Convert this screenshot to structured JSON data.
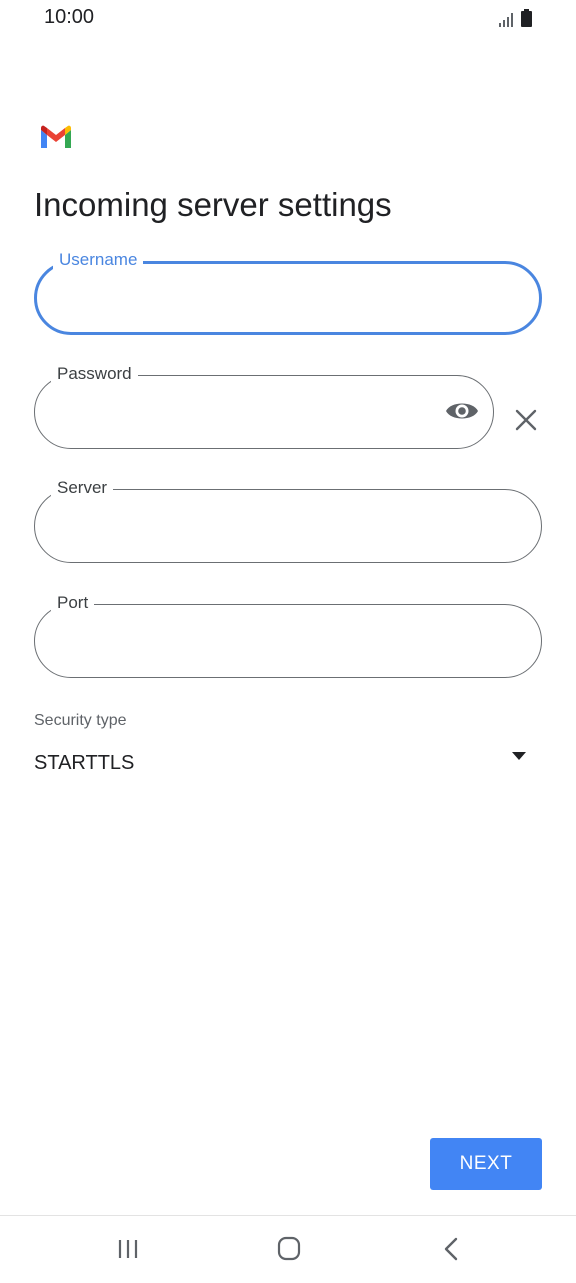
{
  "status_bar": {
    "time": "10:00"
  },
  "page": {
    "title": "Incoming server settings"
  },
  "fields": {
    "username": {
      "label": "Username",
      "value": ""
    },
    "password": {
      "label": "Password",
      "value": ""
    },
    "server": {
      "label": "Server",
      "value": ""
    },
    "port": {
      "label": "Port",
      "value": ""
    }
  },
  "security": {
    "label": "Security type",
    "selected": "STARTTLS"
  },
  "actions": {
    "next_label": "NEXT"
  },
  "icons": {
    "app_logo": "gmail-logo",
    "show_password": "eye-icon",
    "clear": "close-icon",
    "dropdown": "caret-down-icon",
    "nav_recents": "recent-apps-icon",
    "nav_home": "home-icon",
    "nav_back": "back-icon"
  },
  "colors": {
    "accent": "#4285f4",
    "focus": "#4a86e0",
    "outline": "#6b6f73"
  }
}
